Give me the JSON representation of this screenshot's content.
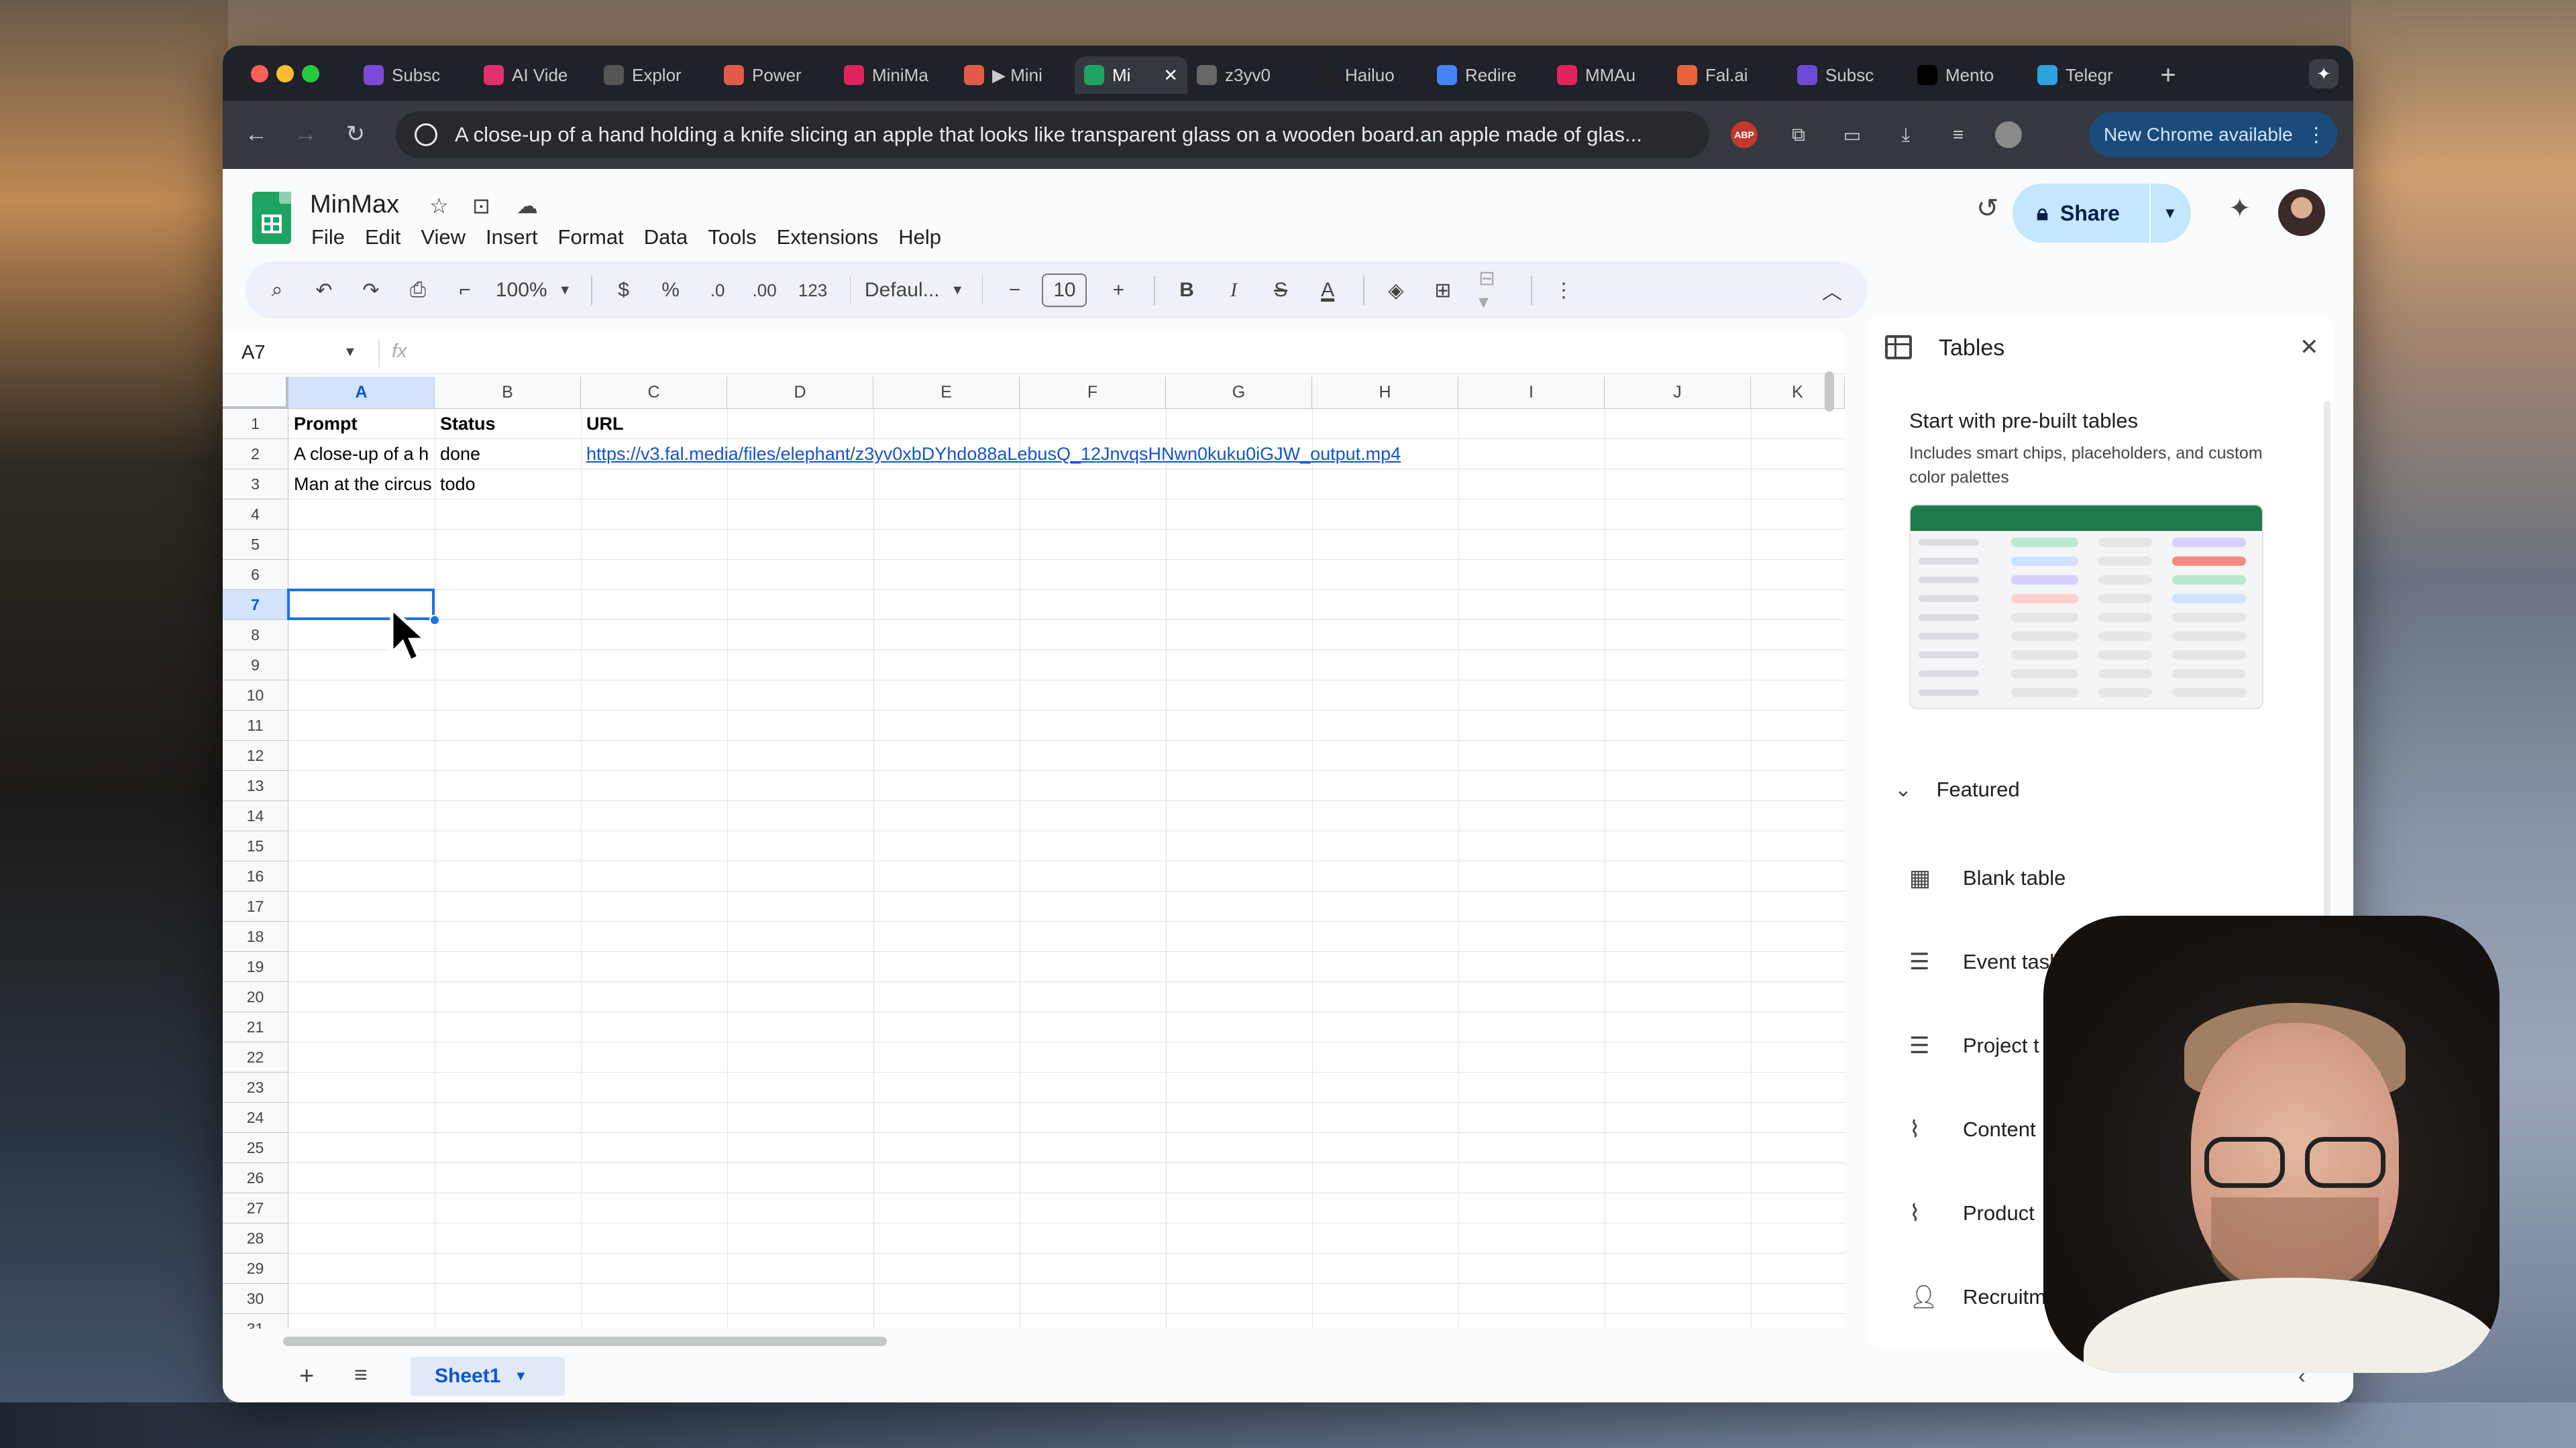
{
  "browser": {
    "tabs": [
      {
        "title": "Subsc",
        "fav_color": "#7b4bd6"
      },
      {
        "title": "AI Vide",
        "fav_color": "#e1306c"
      },
      {
        "title": "Explor",
        "fav_color": "#555555"
      },
      {
        "title": "Power",
        "fav_color": "#e25a4a"
      },
      {
        "title": "MiniMa",
        "fav_color": "#e0245e"
      },
      {
        "title": "▶ Mini",
        "fav_color": "#e25a4a"
      },
      {
        "title": "Mi",
        "fav_color": "#1ea362",
        "active": true
      },
      {
        "title": "z3yv0",
        "fav_color": "#666666"
      },
      {
        "title": "Hailuo",
        "fav_color": "#222222"
      },
      {
        "title": "Redire",
        "fav_color": "#4285f4"
      },
      {
        "title": "MMAu",
        "fav_color": "#e0245e"
      },
      {
        "title": "Fal.ai",
        "fav_color": "#e8643a"
      },
      {
        "title": "Subsc",
        "fav_color": "#6a4bd6"
      },
      {
        "title": "Mento",
        "fav_color": "#000000"
      },
      {
        "title": "Telegr",
        "fav_color": "#2aa3df"
      }
    ],
    "new_tab": "+",
    "address": "A close-up of a hand holding a knife slicing an apple that looks like transparent glass on a wooden board.an apple made of glas...",
    "update_label": "New Chrome available"
  },
  "sheets": {
    "doc_title": "MinMax",
    "menu": [
      "File",
      "Edit",
      "View",
      "Insert",
      "Format",
      "Data",
      "Tools",
      "Extensions",
      "Help"
    ],
    "share_label": "Share",
    "toolbar": {
      "zoom": "100%",
      "currency": "$",
      "percent": "%",
      "dec_less": ".0",
      "dec_more": ".00",
      "number_format": "123",
      "font": "Defaul...",
      "font_size": "10",
      "bold": "B",
      "italic": "I",
      "strike": "S",
      "text_color": "A"
    },
    "name_box": "A7",
    "fx": "fx",
    "columns": [
      "A",
      "B",
      "C",
      "D",
      "E",
      "F",
      "G",
      "H",
      "I",
      "J",
      "K"
    ],
    "selected_column": "A",
    "rows": [
      "1",
      "2",
      "3",
      "4",
      "5",
      "6",
      "7",
      "8",
      "9",
      "10",
      "11",
      "12",
      "13",
      "14",
      "15",
      "16",
      "17",
      "18",
      "19",
      "20",
      "21",
      "22",
      "23",
      "24",
      "25",
      "26",
      "27",
      "28",
      "29",
      "30",
      "31"
    ],
    "selected_row": "7",
    "cells": {
      "a1": "Prompt",
      "b1": "Status",
      "c1": "URL",
      "a2": "A close-up of a h",
      "b2": "done",
      "c2": "https://v3.fal.media/files/elephant/z3yv0xbDYhdo88aLebusQ_12JnvqsHNwn0kuku0iGJW_output.mp4",
      "a3": "Man at the circus",
      "b3": "todo"
    },
    "sheet_tab": "Sheet1"
  },
  "panel": {
    "title": "Tables",
    "heading": "Start with pre-built tables",
    "description": "Includes smart chips, placeholders, and custom color palettes",
    "featured": "Featured",
    "items": [
      {
        "label": "Blank table",
        "icon": "table-icon"
      },
      {
        "label": "Event tasks",
        "icon": "checklist-icon"
      },
      {
        "label": "Project t",
        "icon": "checklist-icon"
      },
      {
        "label": "Content",
        "icon": "trend-icon"
      },
      {
        "label": "Product",
        "icon": "trend-icon"
      },
      {
        "label": "Recruitm",
        "icon": "person-icon"
      }
    ]
  }
}
